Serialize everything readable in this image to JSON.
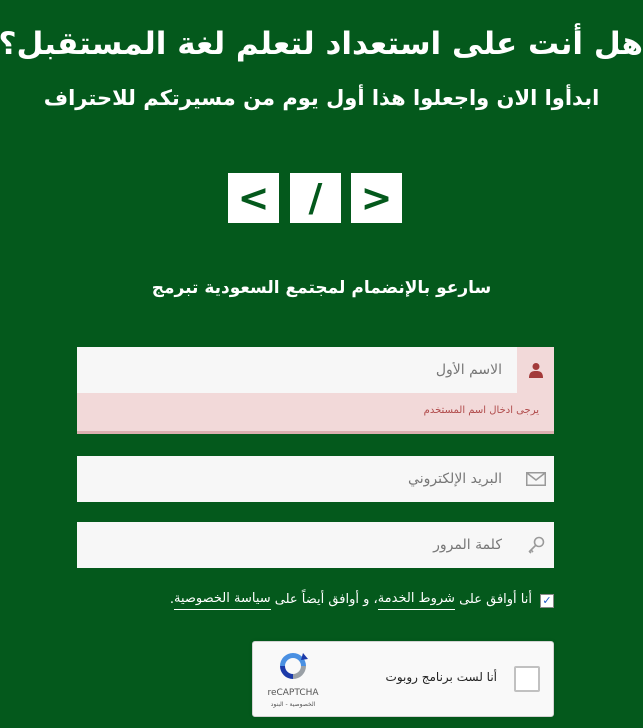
{
  "header": {
    "title": "هل أنت على استعداد لتعلم لغة المستقبل؟",
    "subtitle": "ابدأوا الان واجعلوا هذا أول يوم من مسيرتكم للاحتراف"
  },
  "logo": {
    "left": "<",
    "middle": "/",
    "right": ">"
  },
  "join": {
    "text": "سارعو بالإنضمام لمجتمع السعودية تبرمج"
  },
  "form": {
    "first_name": {
      "placeholder": "الاسم الأول",
      "value": "",
      "error": "يرجى ادخال اسم المستخدم"
    },
    "email": {
      "placeholder": "البريد الإلكتروني",
      "value": ""
    },
    "password": {
      "placeholder": "كلمة المرور",
      "value": ""
    },
    "terms": {
      "checked": true,
      "part1": "أنا أوافق على",
      "link_service": "شروط الخدمة",
      "part2": "، و أوافق أيضاً على",
      "link_privacy": "سياسة الخصوصية",
      "end": "."
    }
  },
  "captcha": {
    "label": "أنا لست برنامج روبوت",
    "brand": "reCAPTCHA",
    "links": "الخصوصية - البنود"
  },
  "colors": {
    "background": "#04591c",
    "error_bg": "#f2d9d9",
    "error_text": "#b04a4a",
    "error_icon": "#a33a3a"
  }
}
